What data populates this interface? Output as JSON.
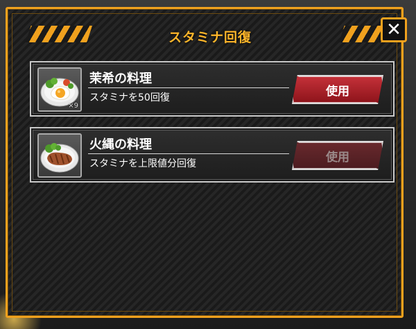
{
  "dialog": {
    "title": "スタミナ回復",
    "close_icon": "✕"
  },
  "items": [
    {
      "name": "茉希の料理",
      "description": "スタミナを50回復",
      "count": "×9",
      "button_label": "使用",
      "button_enabled": true,
      "icon": "fried-egg-dish-icon"
    },
    {
      "name": "火縄の料理",
      "description": "スタミナを上限値分回復",
      "count": "",
      "button_label": "使用",
      "button_enabled": false,
      "icon": "steak-dish-icon"
    }
  ],
  "colors": {
    "frame": "#f0a11e",
    "title": "#ffb62a",
    "button": "#c8333b",
    "button_disabled": "#6a2a2e"
  }
}
